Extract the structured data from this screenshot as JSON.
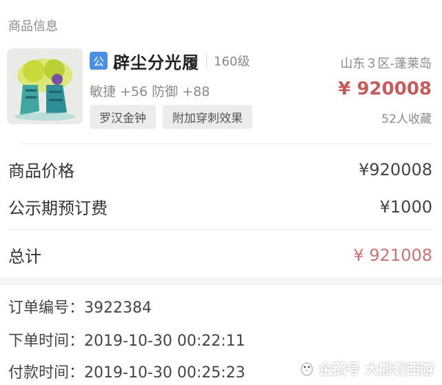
{
  "section_title": "商品信息",
  "product": {
    "badge": "公",
    "name": "辟尘分光履",
    "level": "160级",
    "server": "山东３区-蓬莱岛",
    "stats": "敏捷 +56 防御 +88",
    "price": "¥ 920008",
    "tags": [
      "罗汉金钟",
      "附加穿刺效果"
    ],
    "favorites": "52人收藏",
    "price_color": "#c85a5a",
    "badge_color": "#4a90e2",
    "image_icon": "green-boots-icon"
  },
  "fees": {
    "goods_price_label": "商品价格",
    "goods_price_value": "¥920008",
    "publicity_fee_label": "公示期预订费",
    "publicity_fee_value": "¥1000",
    "total_label": "总计",
    "total_value": "¥ 921008",
    "total_color": "#d07070"
  },
  "order": {
    "number_label": "订单编号：",
    "number_value": "3922384",
    "order_time_label": "下单时间：",
    "order_time_value": "2019-10-30 00:22:11",
    "pay_time_label": "付款时间：",
    "pay_time_value": "2019-10-30 00:25:23"
  },
  "watermark": {
    "text": "企鹅号 大熊看西游",
    "icon": "penguin-icon"
  }
}
